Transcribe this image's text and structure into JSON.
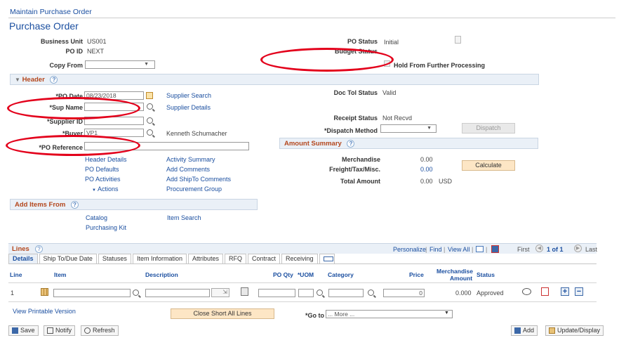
{
  "breadcrumb": "Maintain Purchase Order",
  "page_title": "Purchase Order",
  "top": {
    "business_unit_label": "Business Unit",
    "business_unit": "US001",
    "po_id_label": "PO ID",
    "po_id": "NEXT",
    "copy_from_label": "Copy From",
    "po_status_label": "PO Status",
    "po_status": "Initial",
    "budget_status_label": "Budget Status",
    "hold_label": "Hold From Further Processing"
  },
  "header": {
    "title": "Header",
    "po_date_label": "*PO Date",
    "po_date": "08/23/2018",
    "sup_name_label": "*Sup Name",
    "supplier_id_label": "*Supplier ID",
    "buyer_label": "*Buyer",
    "buyer": "VP1",
    "buyer_name": "Kenneth Schumacher",
    "po_ref_label": "*PO Reference",
    "supplier_search": "Supplier Search",
    "supplier_details": "Supplier Details",
    "doc_tol_label": "Doc Tol Status",
    "doc_tol": "Valid",
    "receipt_status_label": "Receipt Status",
    "receipt_status": "Not Recvd",
    "dispatch_method_label": "*Dispatch Method",
    "dispatch_btn": "Dispatch",
    "links_col1": [
      "Header Details",
      "PO Defaults",
      "PO Activities",
      "Actions"
    ],
    "links_col2": [
      "Activity Summary",
      "Add Comments",
      "Add ShipTo Comments",
      "Procurement Group"
    ]
  },
  "amount": {
    "title": "Amount Summary",
    "merch_label": "Merchandise",
    "merch": "0.00",
    "freight_label": "Freight/Tax/Misc.",
    "freight": "0.00",
    "total_label": "Total Amount",
    "total": "0.00",
    "currency": "USD",
    "calculate": "Calculate"
  },
  "add_items": {
    "title": "Add Items From",
    "catalog": "Catalog",
    "item_search": "Item Search",
    "purchasing_kit": "Purchasing Kit"
  },
  "lines": {
    "title": "Lines",
    "nav": {
      "personalize": "Personalize",
      "find": "Find",
      "view_all": "View All",
      "first": "First",
      "range": "1 of 1",
      "last": "Last"
    },
    "tabs": [
      "Details",
      "Ship To/Due Date",
      "Statuses",
      "Item Information",
      "Attributes",
      "RFQ",
      "Contract",
      "Receiving"
    ],
    "cols": {
      "line": "Line",
      "item": "Item",
      "description": "Description",
      "po_qty": "PO Qty",
      "uom": "*UOM",
      "category": "Category",
      "price": "Price",
      "merch_amount_1": "Merchandise",
      "merch_amount_2": "Amount",
      "status": "Status"
    },
    "row": {
      "line": "1",
      "price": "0",
      "merch_amount": "0.000",
      "status": "Approved"
    }
  },
  "footer": {
    "printable": "View Printable Version",
    "close_short": "Close Short All Lines",
    "goto_label": "*Go to",
    "goto_value": "... More ...",
    "save": "Save",
    "notify": "Notify",
    "refresh": "Refresh",
    "add": "Add",
    "update": "Update/Display"
  },
  "colors": {
    "section_title": "#b4471d",
    "link": "#1b4fa0",
    "annotation": "#e3001b",
    "button": "#fde6c5"
  }
}
